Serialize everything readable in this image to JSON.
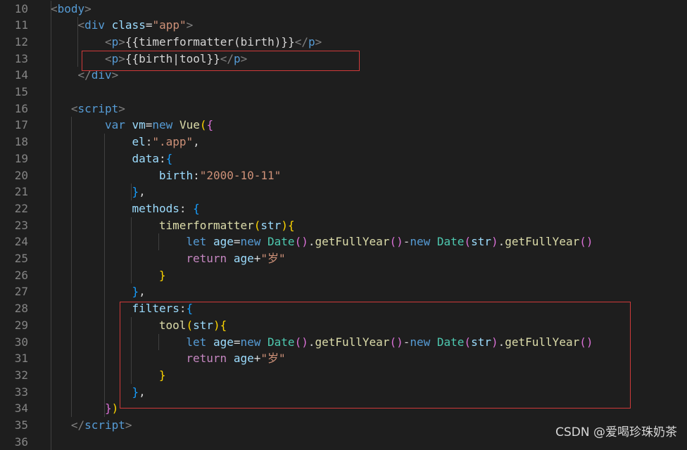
{
  "colors": {
    "background": "#1e1e1e",
    "line_number": "#858585",
    "tag_bracket": "#808080",
    "tag_name": "#569cd6",
    "attr_name": "#9cdcfe",
    "string": "#ce9178",
    "keyword": "#569cd6",
    "control": "#c586c0",
    "function": "#dcdcaa",
    "class": "#4ec9b0",
    "variable": "#9cdcfe",
    "text": "#d4d4d4",
    "bracket_gold": "#ffd700",
    "bracket_pink": "#da70d6",
    "bracket_blue": "#179fff",
    "highlight_box": "#d03a3a"
  },
  "editor": {
    "lines": [
      {
        "num": "10",
        "indent": 0,
        "tokens": [
          {
            "t": "<",
            "c": "tag_bracket"
          },
          {
            "t": "body",
            "c": "tag_name"
          },
          {
            "t": ">",
            "c": "tag_bracket"
          }
        ]
      },
      {
        "num": "11",
        "indent": 4,
        "tokens": [
          {
            "t": "<",
            "c": "tag_bracket"
          },
          {
            "t": "div",
            "c": "tag_name"
          },
          {
            "t": " ",
            "c": "text"
          },
          {
            "t": "class",
            "c": "attr_name"
          },
          {
            "t": "=",
            "c": "text"
          },
          {
            "t": "\"app\"",
            "c": "string"
          },
          {
            "t": ">",
            "c": "tag_bracket"
          }
        ]
      },
      {
        "num": "12",
        "indent": 8,
        "tokens": [
          {
            "t": "<",
            "c": "tag_bracket"
          },
          {
            "t": "p",
            "c": "tag_name"
          },
          {
            "t": ">",
            "c": "tag_bracket"
          },
          {
            "t": "{{timerformatter(birth)}}",
            "c": "text"
          },
          {
            "t": "</",
            "c": "tag_bracket"
          },
          {
            "t": "p",
            "c": "tag_name"
          },
          {
            "t": ">",
            "c": "tag_bracket"
          }
        ]
      },
      {
        "num": "13",
        "indent": 8,
        "tokens": [
          {
            "t": "<",
            "c": "tag_bracket"
          },
          {
            "t": "p",
            "c": "tag_name"
          },
          {
            "t": ">",
            "c": "tag_bracket"
          },
          {
            "t": "{{birth|tool}}",
            "c": "text"
          },
          {
            "t": "</",
            "c": "tag_bracket"
          },
          {
            "t": "p",
            "c": "tag_name"
          },
          {
            "t": ">",
            "c": "tag_bracket"
          }
        ]
      },
      {
        "num": "14",
        "indent": 4,
        "tokens": [
          {
            "t": "</",
            "c": "tag_bracket"
          },
          {
            "t": "div",
            "c": "tag_name"
          },
          {
            "t": ">",
            "c": "tag_bracket"
          }
        ]
      },
      {
        "num": "15",
        "indent": 0,
        "tokens": []
      },
      {
        "num": "16",
        "indent": 3,
        "tokens": [
          {
            "t": "<",
            "c": "tag_bracket"
          },
          {
            "t": "script",
            "c": "tag_name"
          },
          {
            "t": ">",
            "c": "tag_bracket"
          }
        ]
      },
      {
        "num": "17",
        "indent": 8,
        "tokens": [
          {
            "t": "var",
            "c": "keyword"
          },
          {
            "t": " ",
            "c": "text"
          },
          {
            "t": "vm",
            "c": "variable"
          },
          {
            "t": "=",
            "c": "text"
          },
          {
            "t": "new",
            "c": "keyword"
          },
          {
            "t": " ",
            "c": "text"
          },
          {
            "t": "Vue",
            "c": "function"
          },
          {
            "t": "(",
            "c": "bracket_gold"
          },
          {
            "t": "{",
            "c": "bracket_pink"
          }
        ]
      },
      {
        "num": "18",
        "indent": 12,
        "tokens": [
          {
            "t": "el",
            "c": "variable"
          },
          {
            "t": ":",
            "c": "text"
          },
          {
            "t": "\".app\"",
            "c": "string"
          },
          {
            "t": ",",
            "c": "text"
          }
        ]
      },
      {
        "num": "19",
        "indent": 12,
        "tokens": [
          {
            "t": "data",
            "c": "variable"
          },
          {
            "t": ":",
            "c": "text"
          },
          {
            "t": "{",
            "c": "bracket_blue"
          }
        ]
      },
      {
        "num": "20",
        "indent": 16,
        "tokens": [
          {
            "t": "birth",
            "c": "variable"
          },
          {
            "t": ":",
            "c": "text"
          },
          {
            "t": "\"2000-10-11\"",
            "c": "string"
          }
        ]
      },
      {
        "num": "21",
        "indent": 12,
        "tokens": [
          {
            "t": "}",
            "c": "bracket_blue"
          },
          {
            "t": ",",
            "c": "text"
          }
        ]
      },
      {
        "num": "22",
        "indent": 12,
        "tokens": [
          {
            "t": "methods",
            "c": "variable"
          },
          {
            "t": ": ",
            "c": "text"
          },
          {
            "t": "{",
            "c": "bracket_blue"
          }
        ]
      },
      {
        "num": "23",
        "indent": 16,
        "tokens": [
          {
            "t": "timerformatter",
            "c": "function"
          },
          {
            "t": "(",
            "c": "bracket_gold"
          },
          {
            "t": "str",
            "c": "variable"
          },
          {
            "t": ")",
            "c": "bracket_gold"
          },
          {
            "t": "{",
            "c": "bracket_gold"
          }
        ]
      },
      {
        "num": "24",
        "indent": 20,
        "tokens": [
          {
            "t": "let",
            "c": "keyword"
          },
          {
            "t": " ",
            "c": "text"
          },
          {
            "t": "age",
            "c": "variable"
          },
          {
            "t": "=",
            "c": "text"
          },
          {
            "t": "new",
            "c": "keyword"
          },
          {
            "t": " ",
            "c": "text"
          },
          {
            "t": "Date",
            "c": "class"
          },
          {
            "t": "()",
            "c": "bracket_pink"
          },
          {
            "t": ".",
            "c": "text"
          },
          {
            "t": "getFullYear",
            "c": "function"
          },
          {
            "t": "()",
            "c": "bracket_pink"
          },
          {
            "t": "-",
            "c": "text"
          },
          {
            "t": "new",
            "c": "keyword"
          },
          {
            "t": " ",
            "c": "text"
          },
          {
            "t": "Date",
            "c": "class"
          },
          {
            "t": "(",
            "c": "bracket_pink"
          },
          {
            "t": "str",
            "c": "variable"
          },
          {
            "t": ")",
            "c": "bracket_pink"
          },
          {
            "t": ".",
            "c": "text"
          },
          {
            "t": "getFullYear",
            "c": "function"
          },
          {
            "t": "()",
            "c": "bracket_pink"
          }
        ]
      },
      {
        "num": "25",
        "indent": 20,
        "tokens": [
          {
            "t": "return",
            "c": "control"
          },
          {
            "t": " ",
            "c": "text"
          },
          {
            "t": "age",
            "c": "variable"
          },
          {
            "t": "+",
            "c": "text"
          },
          {
            "t": "\"岁\"",
            "c": "string"
          }
        ]
      },
      {
        "num": "26",
        "indent": 16,
        "tokens": [
          {
            "t": "}",
            "c": "bracket_gold"
          }
        ]
      },
      {
        "num": "27",
        "indent": 12,
        "tokens": [
          {
            "t": "}",
            "c": "bracket_blue"
          },
          {
            "t": ",",
            "c": "text"
          }
        ]
      },
      {
        "num": "28",
        "indent": 12,
        "tokens": [
          {
            "t": "filters",
            "c": "variable"
          },
          {
            "t": ":",
            "c": "text"
          },
          {
            "t": "{",
            "c": "bracket_blue"
          }
        ]
      },
      {
        "num": "29",
        "indent": 16,
        "tokens": [
          {
            "t": "tool",
            "c": "function"
          },
          {
            "t": "(",
            "c": "bracket_gold"
          },
          {
            "t": "str",
            "c": "variable"
          },
          {
            "t": ")",
            "c": "bracket_gold"
          },
          {
            "t": "{",
            "c": "bracket_gold"
          }
        ]
      },
      {
        "num": "30",
        "indent": 20,
        "tokens": [
          {
            "t": "let",
            "c": "keyword"
          },
          {
            "t": " ",
            "c": "text"
          },
          {
            "t": "age",
            "c": "variable"
          },
          {
            "t": "=",
            "c": "text"
          },
          {
            "t": "new",
            "c": "keyword"
          },
          {
            "t": " ",
            "c": "text"
          },
          {
            "t": "Date",
            "c": "class"
          },
          {
            "t": "()",
            "c": "bracket_pink"
          },
          {
            "t": ".",
            "c": "text"
          },
          {
            "t": "getFullYear",
            "c": "function"
          },
          {
            "t": "()",
            "c": "bracket_pink"
          },
          {
            "t": "-",
            "c": "text"
          },
          {
            "t": "new",
            "c": "keyword"
          },
          {
            "t": " ",
            "c": "text"
          },
          {
            "t": "Date",
            "c": "class"
          },
          {
            "t": "(",
            "c": "bracket_pink"
          },
          {
            "t": "str",
            "c": "variable"
          },
          {
            "t": ")",
            "c": "bracket_pink"
          },
          {
            "t": ".",
            "c": "text"
          },
          {
            "t": "getFullYear",
            "c": "function"
          },
          {
            "t": "()",
            "c": "bracket_pink"
          }
        ]
      },
      {
        "num": "31",
        "indent": 20,
        "tokens": [
          {
            "t": "return",
            "c": "control"
          },
          {
            "t": " ",
            "c": "text"
          },
          {
            "t": "age",
            "c": "variable"
          },
          {
            "t": "+",
            "c": "text"
          },
          {
            "t": "\"岁\"",
            "c": "string"
          }
        ]
      },
      {
        "num": "32",
        "indent": 16,
        "tokens": [
          {
            "t": "}",
            "c": "bracket_gold"
          }
        ]
      },
      {
        "num": "33",
        "indent": 12,
        "tokens": [
          {
            "t": "}",
            "c": "bracket_blue"
          },
          {
            "t": ",",
            "c": "text"
          }
        ]
      },
      {
        "num": "34",
        "indent": 8,
        "tokens": [
          {
            "t": "}",
            "c": "bracket_pink"
          },
          {
            "t": ")",
            "c": "bracket_gold"
          }
        ]
      },
      {
        "num": "35",
        "indent": 3,
        "tokens": [
          {
            "t": "</",
            "c": "tag_bracket"
          },
          {
            "t": "script",
            "c": "tag_name"
          },
          {
            "t": ">",
            "c": "tag_bracket"
          }
        ]
      },
      {
        "num": "36",
        "indent": 0,
        "tokens": []
      }
    ]
  },
  "watermark": "CSDN @爱喝珍珠奶茶"
}
